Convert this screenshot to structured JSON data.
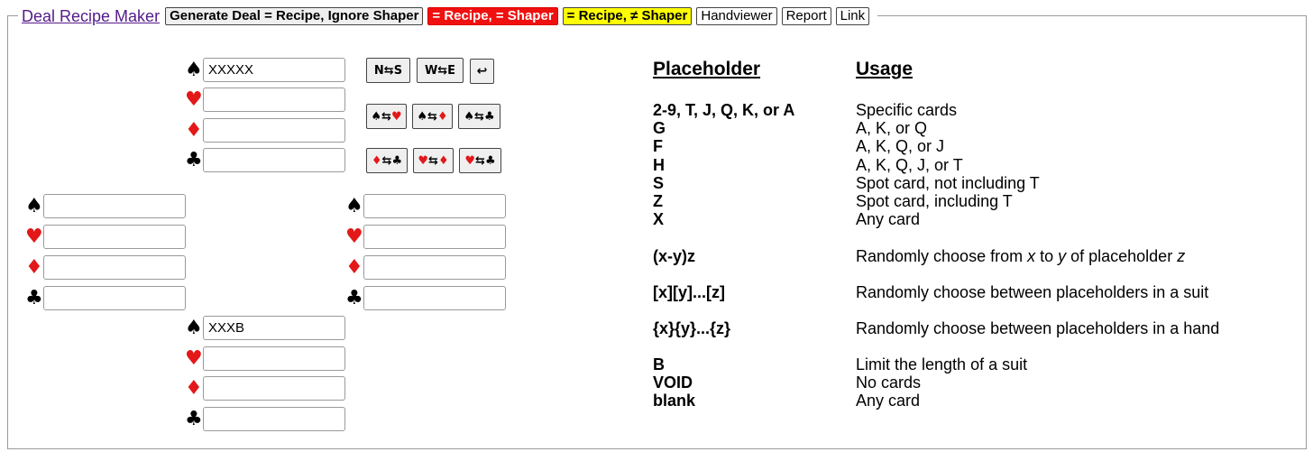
{
  "toolbar": {
    "title": "Deal Recipe Maker",
    "generate_ignore_label": "Generate Deal = Recipe, Ignore Shaper",
    "eq_shaper_label": "= Recipe, = Shaper",
    "neq_shaper_label": "= Recipe, ≠ Shaper",
    "handviewer_label": "Handviewer",
    "report_label": "Report",
    "link_label": "Link"
  },
  "suits": {
    "spades": "♠",
    "hearts": "♥",
    "diamonds": "♦",
    "clubs": "♣"
  },
  "hands": {
    "north": {
      "spades": "XXXXX",
      "hearts": "",
      "diamonds": "",
      "clubs": ""
    },
    "west": {
      "spades": "",
      "hearts": "",
      "diamonds": "",
      "clubs": ""
    },
    "east": {
      "spades": "",
      "hearts": "",
      "diamonds": "",
      "clubs": ""
    },
    "south": {
      "spades": "XXXB",
      "hearts": "",
      "diamonds": "",
      "clubs": ""
    }
  },
  "swap_buttons": {
    "ns": "N⇆S",
    "we": "W⇆E",
    "rotate": "↩",
    "swap_arrow": "⇆"
  },
  "table": {
    "header_placeholder": "Placeholder",
    "header_usage": "Usage",
    "rows": [
      {
        "placeholder": "2-9, T, J, Q, K, or A",
        "usage": "Specific cards"
      },
      {
        "placeholder": "G",
        "usage": "A, K, or Q"
      },
      {
        "placeholder": "F",
        "usage": "A, K, Q, or J"
      },
      {
        "placeholder": "H",
        "usage": "A, K, Q, J, or T"
      },
      {
        "placeholder": "S",
        "usage": "Spot card, not including T"
      },
      {
        "placeholder": "Z",
        "usage": "Spot card, including T"
      },
      {
        "placeholder": "X",
        "usage": "Any card"
      },
      {
        "placeholder": "(x-y)z",
        "usage_parts": [
          "Randomly choose from ",
          "x",
          " to ",
          "y",
          " of placeholder ",
          "z"
        ]
      },
      {
        "placeholder": "[x][y]...[z]",
        "usage": "Randomly choose between placeholders in a suit"
      },
      {
        "placeholder": "{x}{y}...{z}",
        "usage": "Randomly choose between placeholders in a hand"
      },
      {
        "placeholder": "B",
        "usage": "Limit the length of a suit"
      },
      {
        "placeholder": "VOID",
        "usage": "No cards"
      },
      {
        "placeholder": "blank",
        "usage": "Any card"
      }
    ]
  },
  "colors": {
    "red_suit": "#e31818",
    "red_button": "#f01010",
    "yellow_button": "#ffff00",
    "link": "#551a8b"
  }
}
